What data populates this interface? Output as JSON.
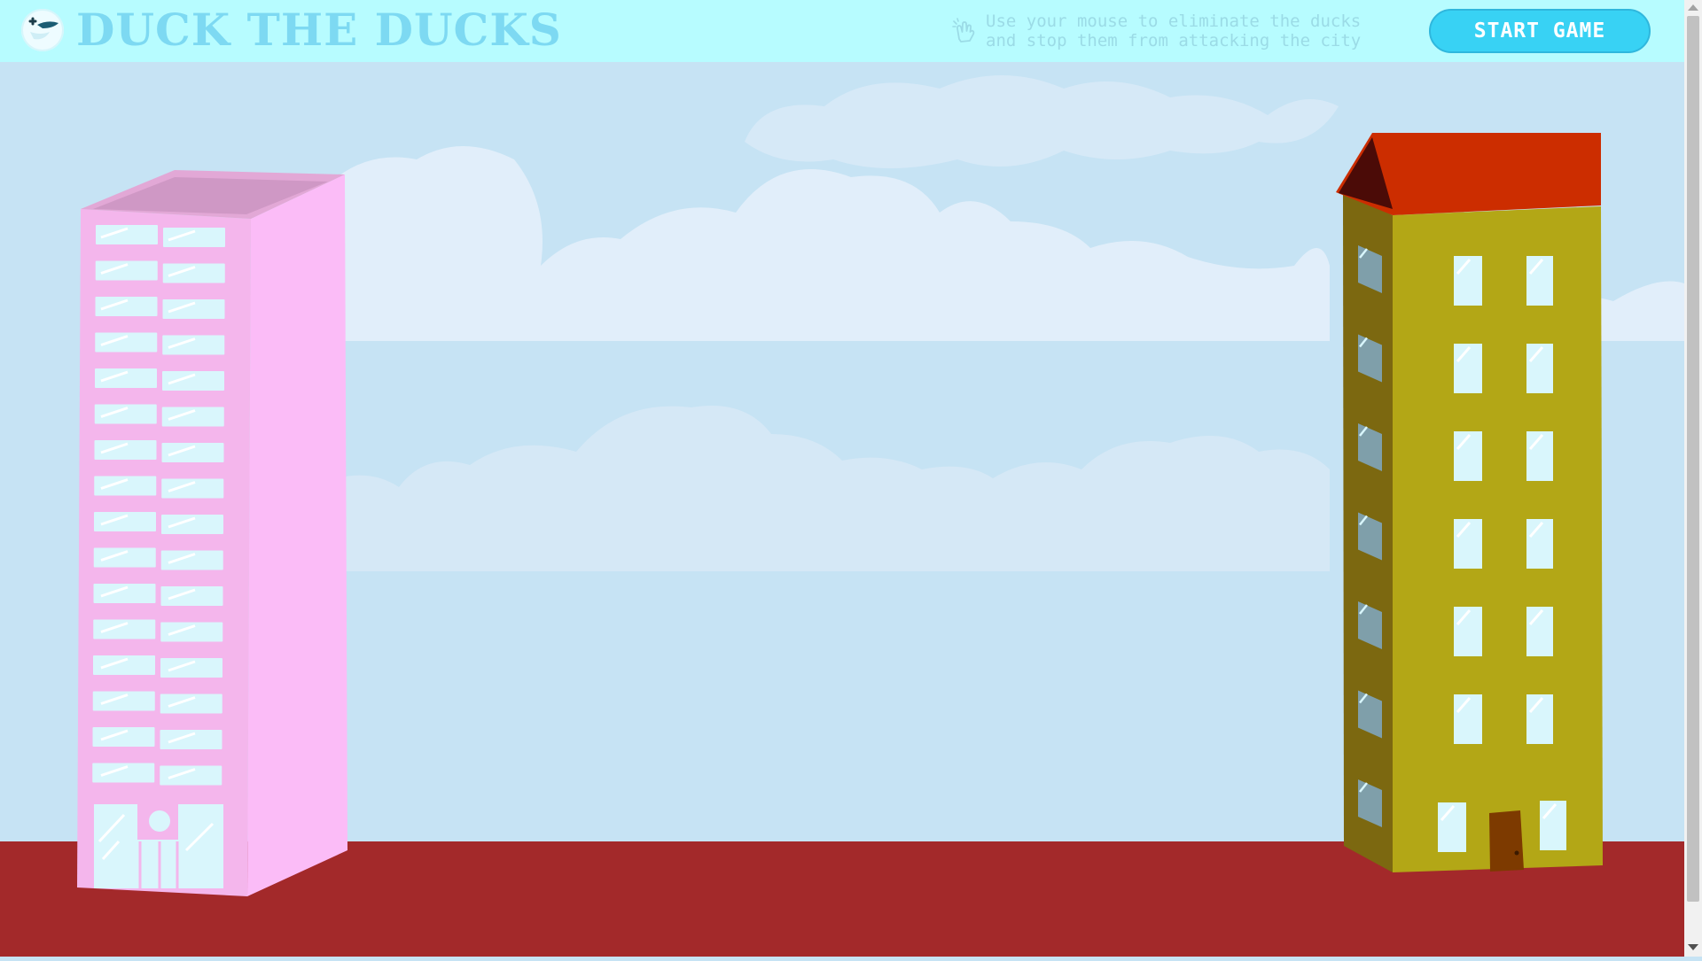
{
  "game": {
    "title": "DUCK THE DUCKS",
    "hint_line1": "Use your mouse to eliminate the ducks",
    "hint_line2": "and stop them from attacking the city",
    "start_label": "START GAME"
  },
  "icons": {
    "logo": "duck-logo-icon",
    "hint": "pointer-hand-icon"
  },
  "colors": {
    "header_bg": "#b7fcff",
    "title": "#7dd9f2",
    "button": "#38d2f4",
    "sky": "#c6e3f4",
    "ground": "#a3292a",
    "pink_building": "#fbbcf7",
    "yellow_building": "#b3a716",
    "roof": "#cc2d00"
  }
}
